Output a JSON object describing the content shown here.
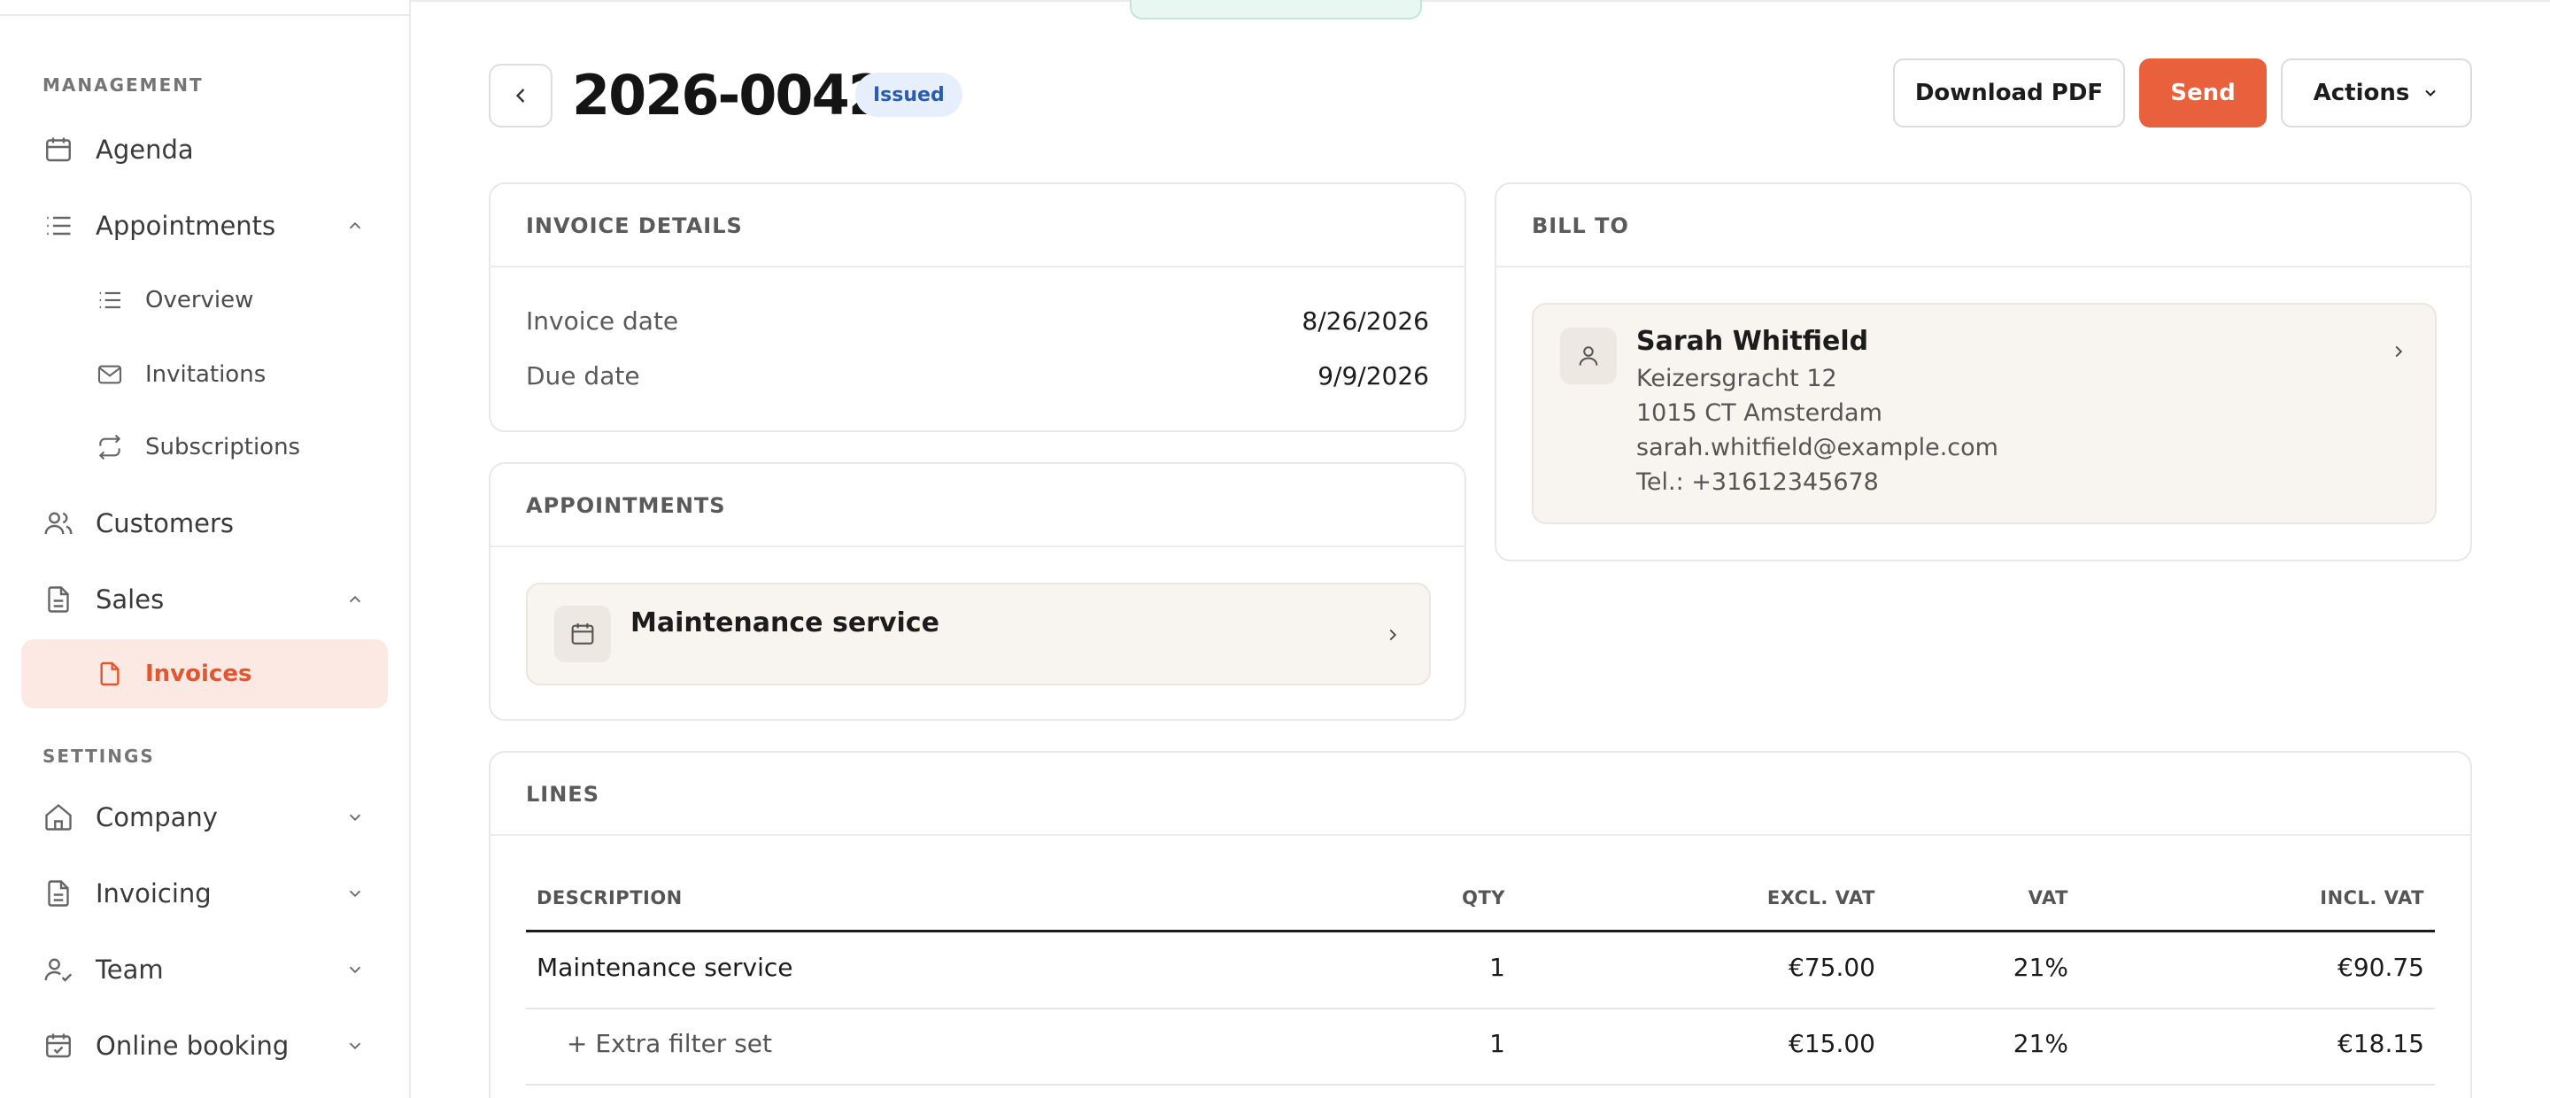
{
  "sidebar": {
    "management_label": "MANAGEMENT",
    "settings_label": "SETTINGS",
    "items": {
      "agenda": "Agenda",
      "appointments": "Appointments",
      "overview": "Overview",
      "invitations": "Invitations",
      "subscriptions": "Subscriptions",
      "customers": "Customers",
      "sales": "Sales",
      "invoices": "Invoices",
      "company": "Company",
      "invoicing": "Invoicing",
      "team": "Team",
      "online_booking": "Online booking"
    }
  },
  "header": {
    "title": "2026-0042",
    "status": "Issued",
    "download_pdf": "Download PDF",
    "send": "Send",
    "actions": "Actions"
  },
  "invoice_details": {
    "heading": "INVOICE DETAILS",
    "invoice_date_label": "Invoice date",
    "invoice_date": "8/26/2026",
    "due_date_label": "Due date",
    "due_date": "9/9/2026"
  },
  "bill_to": {
    "heading": "BILL TO",
    "name": "Sarah Whitfield",
    "address_line1": "Keizersgracht 12",
    "address_line2": "1015 CT Amsterdam",
    "email": "sarah.whitfield@example.com",
    "phone": "Tel.: +31612345678"
  },
  "appointments": {
    "heading": "APPOINTMENTS",
    "item": "Maintenance service"
  },
  "lines": {
    "heading": "LINES",
    "columns": {
      "description": "DESCRIPTION",
      "qty": "QTY",
      "excl": "EXCL. VAT",
      "vat": "VAT",
      "incl": "INCL. VAT"
    },
    "rows": [
      {
        "description": "Maintenance service",
        "qty": "1",
        "excl": "€75.00",
        "vat": "21%",
        "incl": "€90.75"
      },
      {
        "description": "+ Extra filter set",
        "qty": "1",
        "excl": "€15.00",
        "vat": "21%",
        "incl": "€18.15"
      }
    ]
  },
  "colors": {
    "accent": "#e8603c",
    "active_bg": "#fde9e3",
    "badge_bg": "#e6effb",
    "badge_text": "#2a5db0"
  }
}
